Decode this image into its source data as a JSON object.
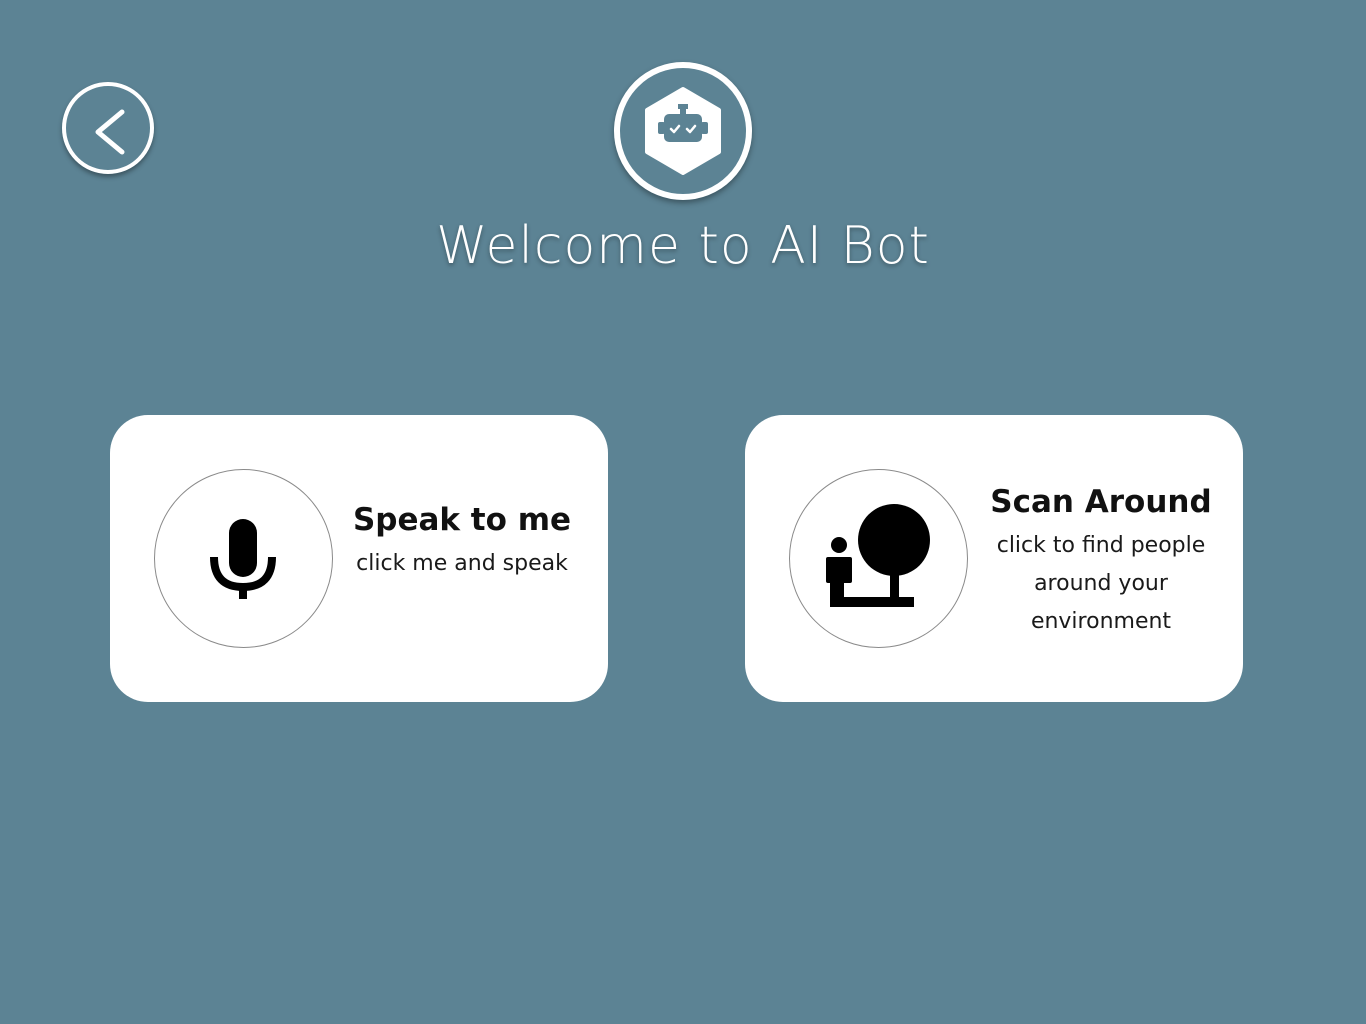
{
  "header": {
    "back_icon": "chevron-left-icon",
    "logo_icon": "robot-hexagon-icon",
    "title": "Welcome to AI Bot"
  },
  "cards": [
    {
      "icon": "microphone-icon",
      "title": "Speak to me",
      "subtitle": "click me and speak"
    },
    {
      "icon": "person-tree-scan-icon",
      "title": "Scan Around",
      "subtitle": "click to find people around your environment"
    }
  ],
  "colors": {
    "background": "#5c8394",
    "card": "#ffffff",
    "icon": "#000000",
    "title_text": "#ffffff"
  }
}
